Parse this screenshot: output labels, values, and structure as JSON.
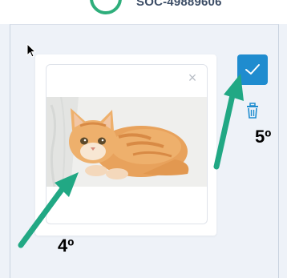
{
  "header": {
    "record_code": "SOC-49889606"
  },
  "image_card": {
    "close_symbol": "×",
    "image_description_icon": "kitten-photo"
  },
  "actions": {
    "checkbox_icon": "check-icon",
    "checkbox_checked": true,
    "delete_icon": "trash-icon"
  },
  "annotations": {
    "label_a": "5º",
    "label_b": "4º",
    "arrow_color": "#21a884"
  },
  "colors": {
    "accent": "#1f8ccf",
    "panel_bg": "#eef2f8",
    "badge_green": "#2eae7b"
  }
}
